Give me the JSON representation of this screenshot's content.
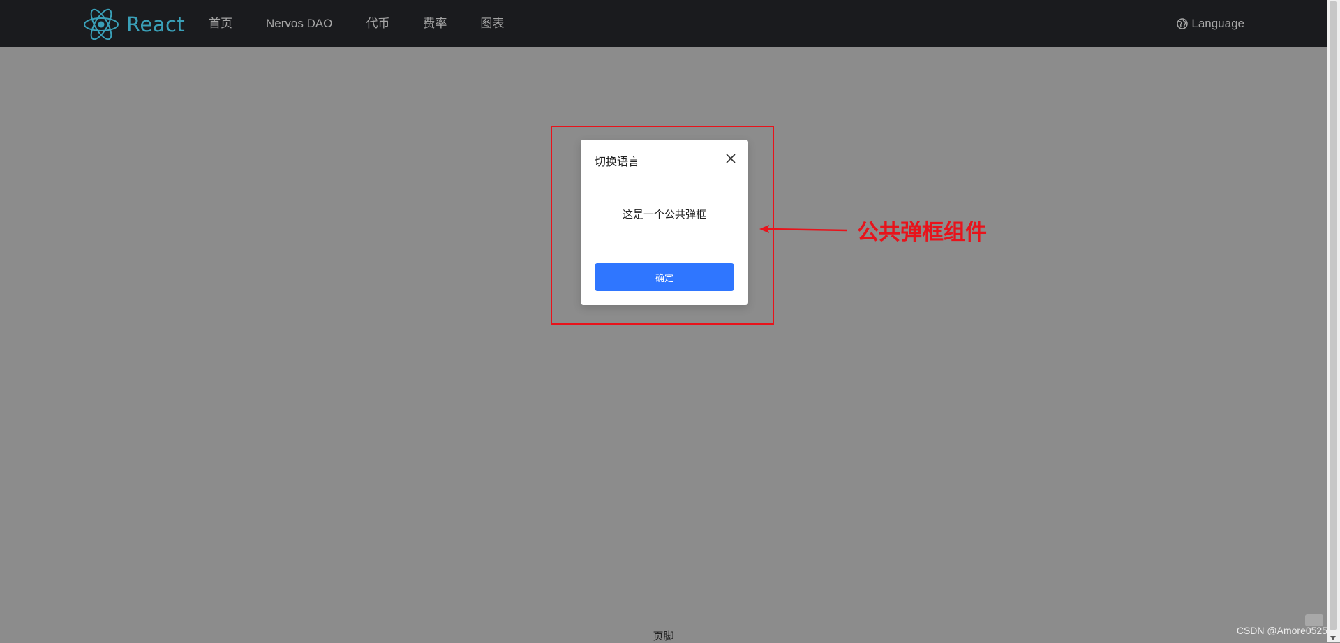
{
  "header": {
    "logo_text": "React",
    "logo_icon": "react-atom-icon",
    "nav": [
      {
        "label": "首页"
      },
      {
        "label": "Nervos DAO"
      },
      {
        "label": "代币"
      },
      {
        "label": "费率"
      },
      {
        "label": "图表"
      }
    ],
    "language_label": "Language",
    "language_icon": "globe-icon"
  },
  "modal": {
    "title": "切换语言",
    "body": "这是一个公共弹框",
    "confirm_label": "确定",
    "close_icon": "close-icon"
  },
  "annotation": {
    "text": "公共弹框组件",
    "color": "#e8131b"
  },
  "footer": {
    "text": "页脚"
  },
  "watermark": "CSDN @Amore0525",
  "colors": {
    "header_bg": "#1a1b1e",
    "overlay_bg": "#8c8c8c",
    "primary": "#2f76ff",
    "logo": "#3aa0b8"
  }
}
